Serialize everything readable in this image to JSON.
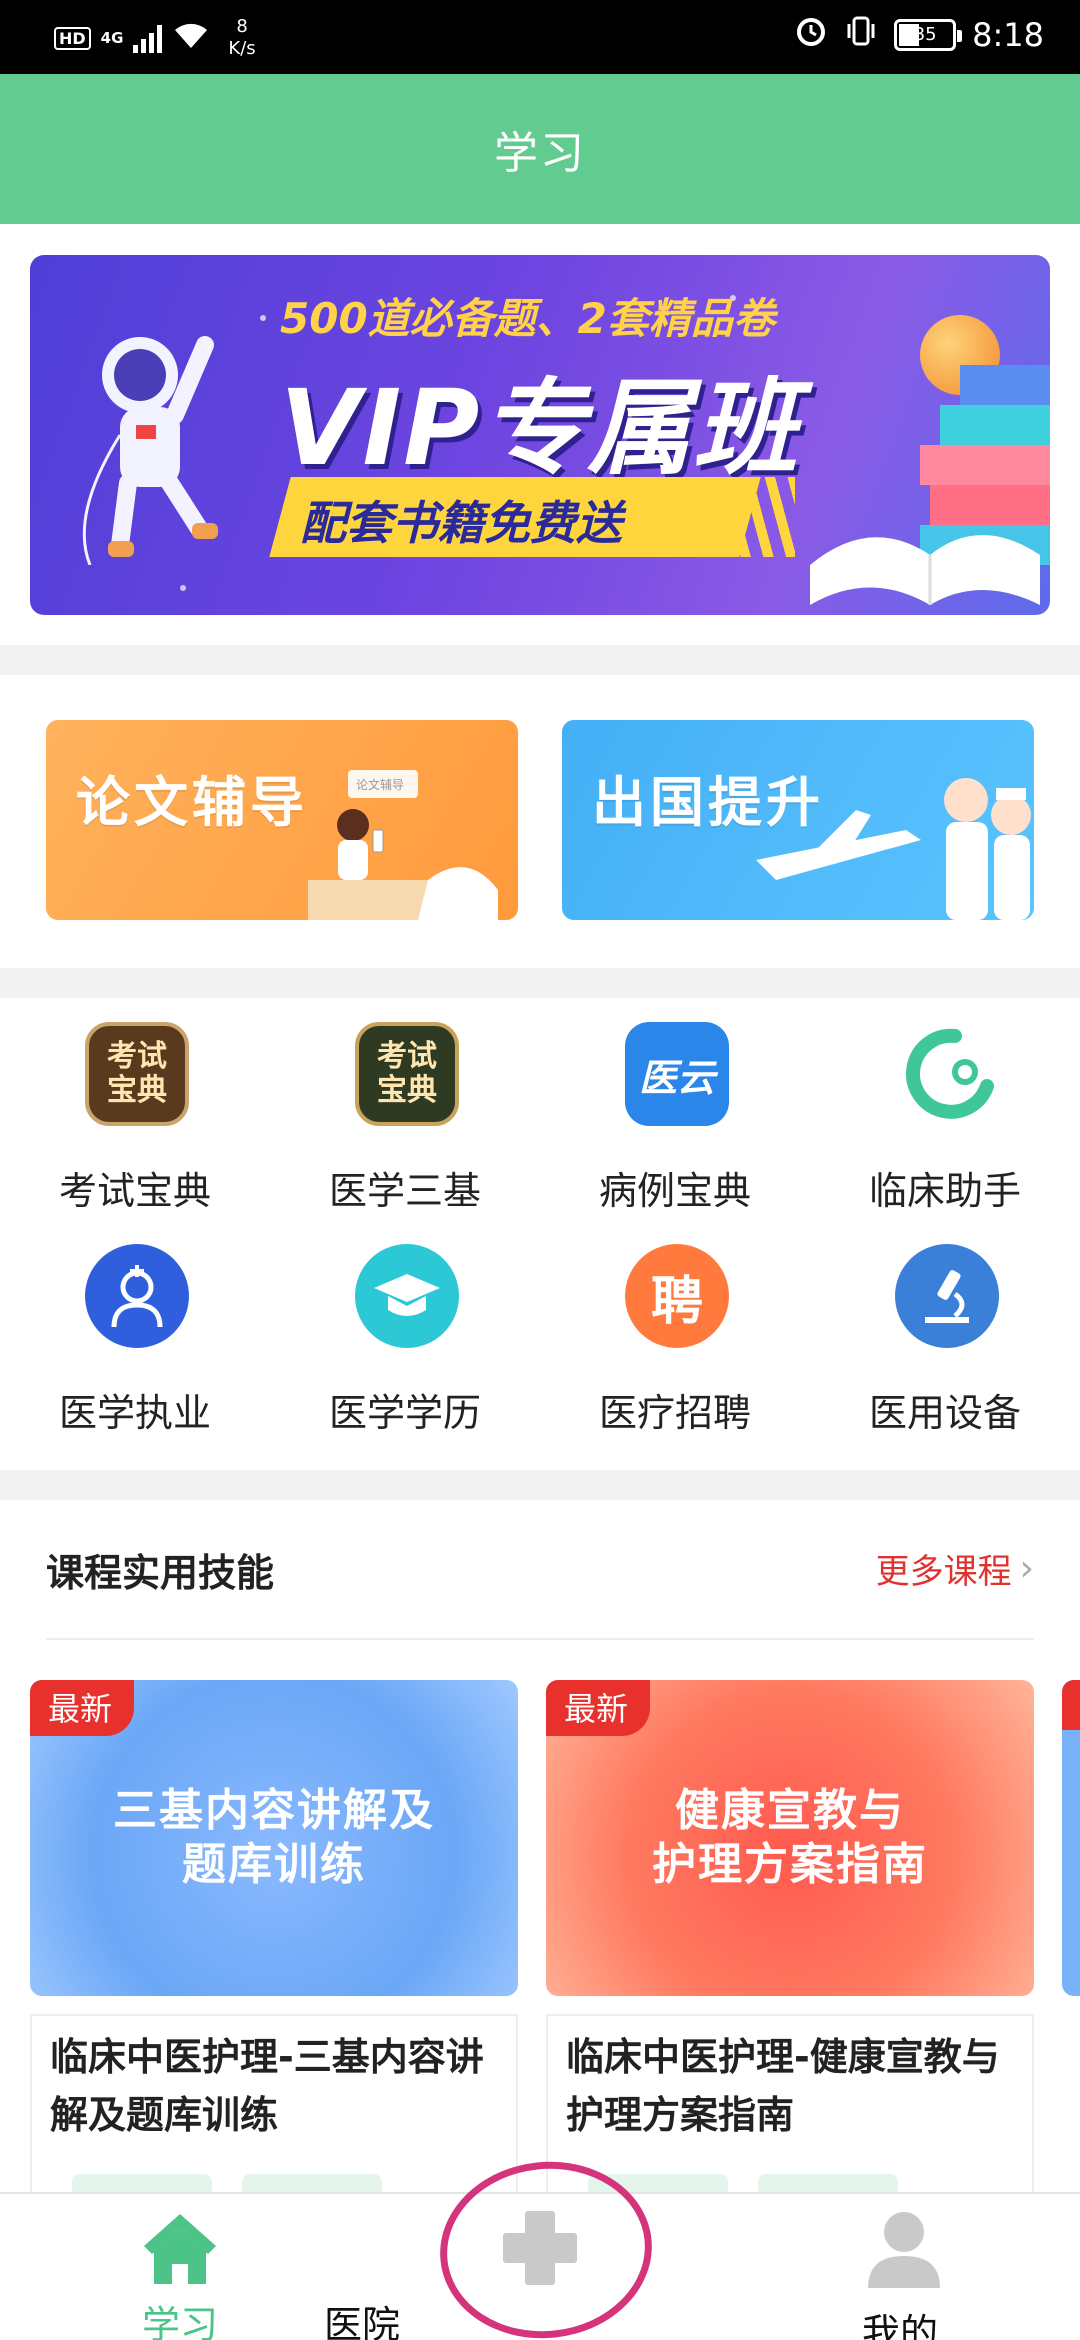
{
  "status_bar": {
    "hd": "HD",
    "network": "4G",
    "speed_value": "8",
    "speed_unit": "K/s",
    "battery": "35",
    "time": "8:18"
  },
  "header": {
    "title": "学习"
  },
  "banner": {
    "subtitle": "500道必备题、2套精品卷",
    "title": "VIP专属班",
    "ribbon": "配套书籍免费送"
  },
  "promos": [
    {
      "label": "论文辅导",
      "art_text": "论文辅导"
    },
    {
      "label": "出国提升"
    }
  ],
  "grid": [
    {
      "label": "考试宝典",
      "icon": "exam-book-icon",
      "glyph": "考试\n宝典",
      "color": "#5a3a1e"
    },
    {
      "label": "医学三基",
      "icon": "medical-basics-icon",
      "glyph": "考试\n宝典",
      "color": "#2f3a22"
    },
    {
      "label": "病例宝典",
      "icon": "case-book-icon",
      "glyph": "医云",
      "color": "#2a86e8"
    },
    {
      "label": "临床助手",
      "icon": "stethoscope-icon",
      "glyph": "",
      "color": "#ffffff"
    },
    {
      "label": "医学执业",
      "icon": "doctor-icon",
      "glyph": "",
      "color": "#2f5fdc"
    },
    {
      "label": "医学学历",
      "icon": "graduation-cap-icon",
      "glyph": "",
      "color": "#2cc8d6"
    },
    {
      "label": "医疗招聘",
      "icon": "recruit-icon",
      "glyph": "聘",
      "color": "#ff7a3c"
    },
    {
      "label": "医用设备",
      "icon": "microscope-icon",
      "glyph": "",
      "color": "#3a7fd8"
    }
  ],
  "courses_section": {
    "title": "课程实用技能",
    "more": "更多课程"
  },
  "courses": [
    {
      "tag": "最新",
      "thumb_line1": "三基内容讲解及",
      "thumb_line2": "题库训练",
      "name": "临床中医护理-三基内容讲解及题库训练"
    },
    {
      "tag": "最新",
      "thumb_line1": "健康宣教与",
      "thumb_line2": "护理方案指南",
      "name": "临床中医护理-健康宣教与护理方案指南"
    }
  ],
  "bottom_nav": [
    {
      "label": "学习",
      "icon": "home-icon",
      "active": true
    },
    {
      "label": "医院",
      "icon": "hospital-cross-icon",
      "active": false
    },
    {
      "label": "我的",
      "icon": "profile-icon",
      "active": false
    }
  ],
  "colors": {
    "accent": "#62cb90",
    "red": "#e0332f",
    "annotation": "#d6337d"
  }
}
